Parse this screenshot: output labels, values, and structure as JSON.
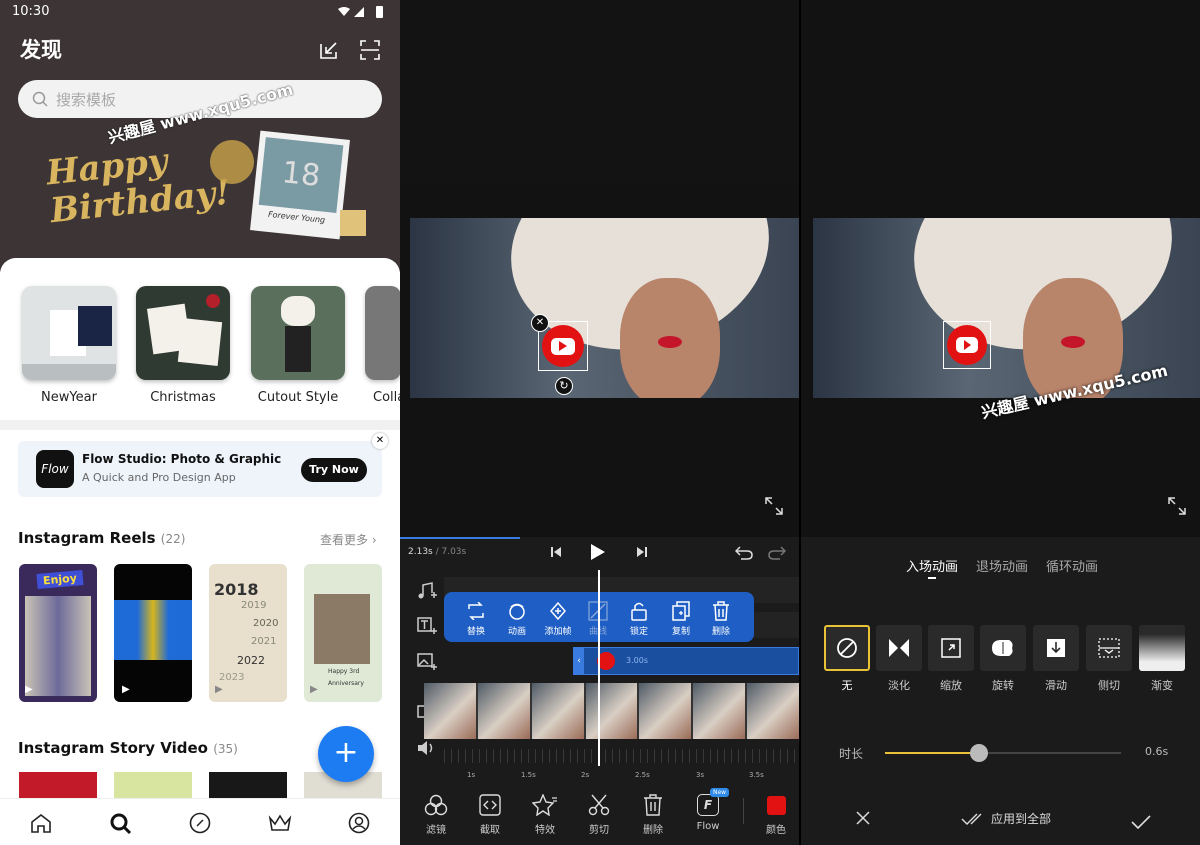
{
  "panel1": {
    "status_time": "10:30",
    "title": "发现",
    "search_placeholder": "搜索模板",
    "watermark": "兴趣屋 www.xqu5.com",
    "banner": {
      "line1": "Happy",
      "line2": "Birthday!",
      "photo_caption": "Forever Young",
      "balloon": "18"
    },
    "categories": [
      "NewYear",
      "Christmas",
      "Cutout Style",
      "Colla"
    ],
    "ad": {
      "logo": "Flow",
      "title": "Flow Studio: Photo & Graphic",
      "subtitle": "A Quick and Pro Design App",
      "cta": "Try Now"
    },
    "reels": {
      "title": "Instagram Reels",
      "count": "(22)",
      "more": "查看更多"
    },
    "reel_texts": {
      "enjoy": "Enjoy",
      "years": [
        "2018",
        "2019",
        "2020",
        "2021",
        "2022",
        "2023"
      ],
      "birthday": "Happy 3rd",
      "anniv": "Anniversary"
    },
    "story": {
      "title": "Instagram Story Video",
      "count": "(35)"
    },
    "colors": {
      "header_bg": "#3d3535",
      "fab": "#1e7cf2"
    }
  },
  "panel2": {
    "time_current": "2.13s",
    "time_total": " / 7.03s",
    "popup_items": [
      "替换",
      "动画",
      "添加帧",
      "曲线",
      "锁定",
      "复制",
      "删除"
    ],
    "clip_time": "3.00s",
    "ticks": [
      "1s",
      "1.5s",
      "2s",
      "2.5s",
      "3s",
      "3.5s"
    ],
    "toolbar": [
      "滤镜",
      "截取",
      "特效",
      "剪切",
      "删除",
      "Flow",
      "颜色"
    ],
    "new_badge": "New",
    "colors": {
      "popup": "#1f5fc5",
      "track": "#1a4fa0",
      "color_swatch": "#e31212"
    }
  },
  "panel3": {
    "watermark": "兴趣屋 www.xqu5.com",
    "tabs": [
      "入场动画",
      "退场动画",
      "循环动画"
    ],
    "animations": [
      "无",
      "淡化",
      "缩放",
      "旋转",
      "滑动",
      "侧切",
      "渐变"
    ],
    "duration_label": "时长",
    "duration_value": "0.6s",
    "duration_fraction": 0.4,
    "apply_all": "应用到全部",
    "colors": {
      "accent": "#e8c338"
    }
  }
}
